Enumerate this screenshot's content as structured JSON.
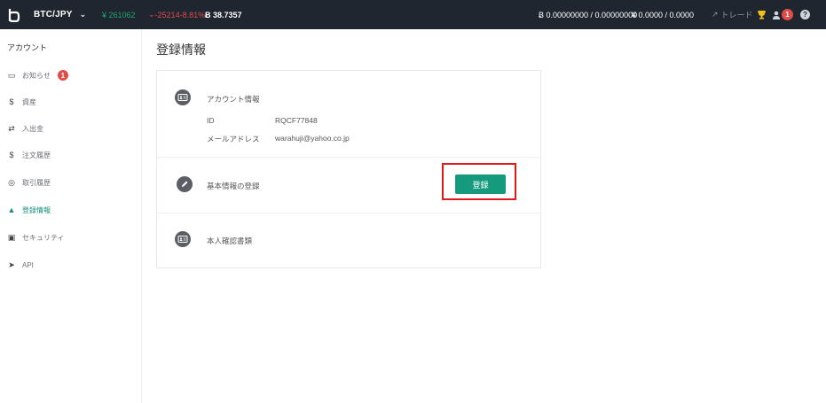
{
  "topbar": {
    "pair": "BTC/JPY",
    "price": "¥ 261062",
    "change": "-25214-8.81%",
    "volume": "Ƀ 38.7357",
    "btc_balance": "Ƀ 0.00000000 / 0.00000000",
    "jpy_balance": "¥ 0.0000 / 0.0000",
    "trade_label": "トレード",
    "notification_count": "1",
    "help": "?"
  },
  "sidebar": {
    "title": "アカウント",
    "items": [
      {
        "label": "お知らせ",
        "icon": "inbox-icon",
        "badge": "1"
      },
      {
        "label": "資産",
        "icon": "dollar-icon"
      },
      {
        "label": "入出金",
        "icon": "transfer-icon"
      },
      {
        "label": "注文履歴",
        "icon": "dollar-icon"
      },
      {
        "label": "取引履歴",
        "icon": "history-icon"
      },
      {
        "label": "登録情報",
        "icon": "user-icon",
        "active": true
      },
      {
        "label": "セキュリティ",
        "icon": "lock-icon"
      },
      {
        "label": "API",
        "icon": "send-icon"
      }
    ]
  },
  "main": {
    "title": "登録情報",
    "account_info": {
      "label": "アカウント情報",
      "id_key": "ID",
      "id_value": "RQCF77848",
      "email_key": "メールアドレス",
      "email_value": "warahuji@yahoo.co.jp"
    },
    "basic_info": {
      "label": "基本情報の登録",
      "button": "登録"
    },
    "identity_docs": {
      "label": "本人確認書類"
    }
  },
  "colors": {
    "topbar_bg": "#1f2630",
    "accent_green": "#159a7d",
    "badge_red": "#e24b47",
    "highlight_red": "#e0191f"
  }
}
